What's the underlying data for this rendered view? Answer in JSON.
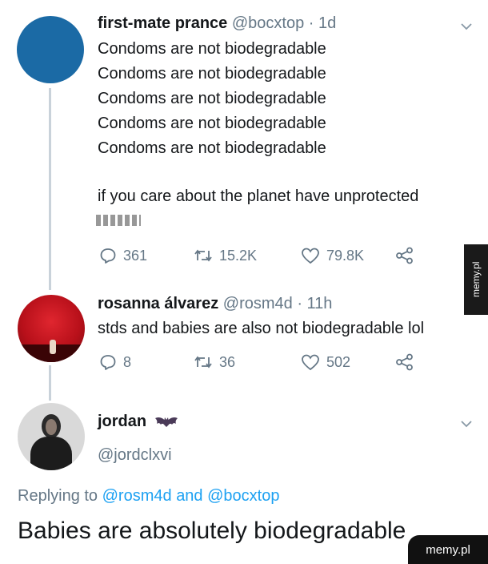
{
  "tweet1": {
    "name": "first-mate prance",
    "handle": "@bocxtop · 1d",
    "lines": [
      "Condoms are not biodegradable",
      "Condoms are not biodegradable",
      "Condoms are not biodegradable",
      "Condoms are not biodegradable",
      "Condoms are not biodegradable"
    ],
    "line2": "if you care about the planet have unprotected",
    "replies": "361",
    "retweets": "15.2K",
    "likes": "79.8K",
    "avatar_color": "#1b6aa5"
  },
  "tweet2": {
    "name": "rosanna álvarez",
    "handle": "@rosm4d · 11h",
    "text": "stds and babies are also not biodegradable lol",
    "replies": "8",
    "retweets": "36",
    "likes": "502",
    "avatar_color": "#c1121f"
  },
  "tweet3": {
    "name": "jordan",
    "handle": "@jordclxvi",
    "replying_prefix": "Replying to",
    "mention1": "@rosm4d",
    "and": "and",
    "mention2": "@bocxtop",
    "text": "Babies are absolutely biodegradable"
  },
  "watermarks": {
    "side": "memy.pl",
    "corner": "memy.pl"
  },
  "colors": {
    "link": "#1da1f2",
    "muted": "#657786",
    "thread": "#c9d2da"
  }
}
